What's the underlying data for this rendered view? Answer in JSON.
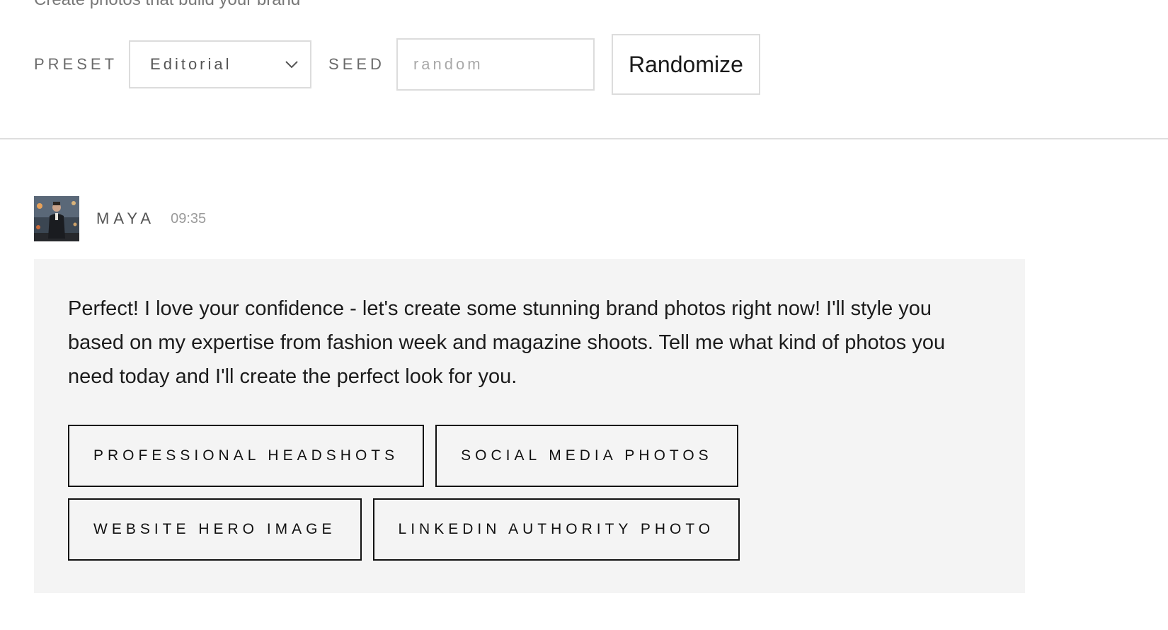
{
  "header": {
    "subtitle": "Create photos that build your brand"
  },
  "toolbar": {
    "preset_label": "PRESET",
    "preset_value": "Editorial",
    "seed_label": "SEED",
    "seed_placeholder": "random",
    "seed_value": "",
    "randomize_label": "Randomize"
  },
  "message": {
    "author": "MAYA",
    "time": "09:35",
    "avatar_icon": "person-photo-avatar",
    "text": "Perfect! I love your confidence - let's create some stunning brand photos right now! I'll style you based on my expertise from fashion week and magazine shoots. Tell me what kind of photos you need today and I'll create the perfect look for you.",
    "options": [
      {
        "label": "PROFESSIONAL HEADSHOTS"
      },
      {
        "label": "SOCIAL MEDIA PHOTOS"
      },
      {
        "label": "WEBSITE HERO IMAGE"
      },
      {
        "label": "LINKEDIN AUTHORITY PHOTO"
      }
    ]
  },
  "colors": {
    "bubble_bg": "#f4f4f4",
    "border_light": "#dcdcdc",
    "border_dark": "#111111",
    "muted_text": "#6a6a6a"
  }
}
